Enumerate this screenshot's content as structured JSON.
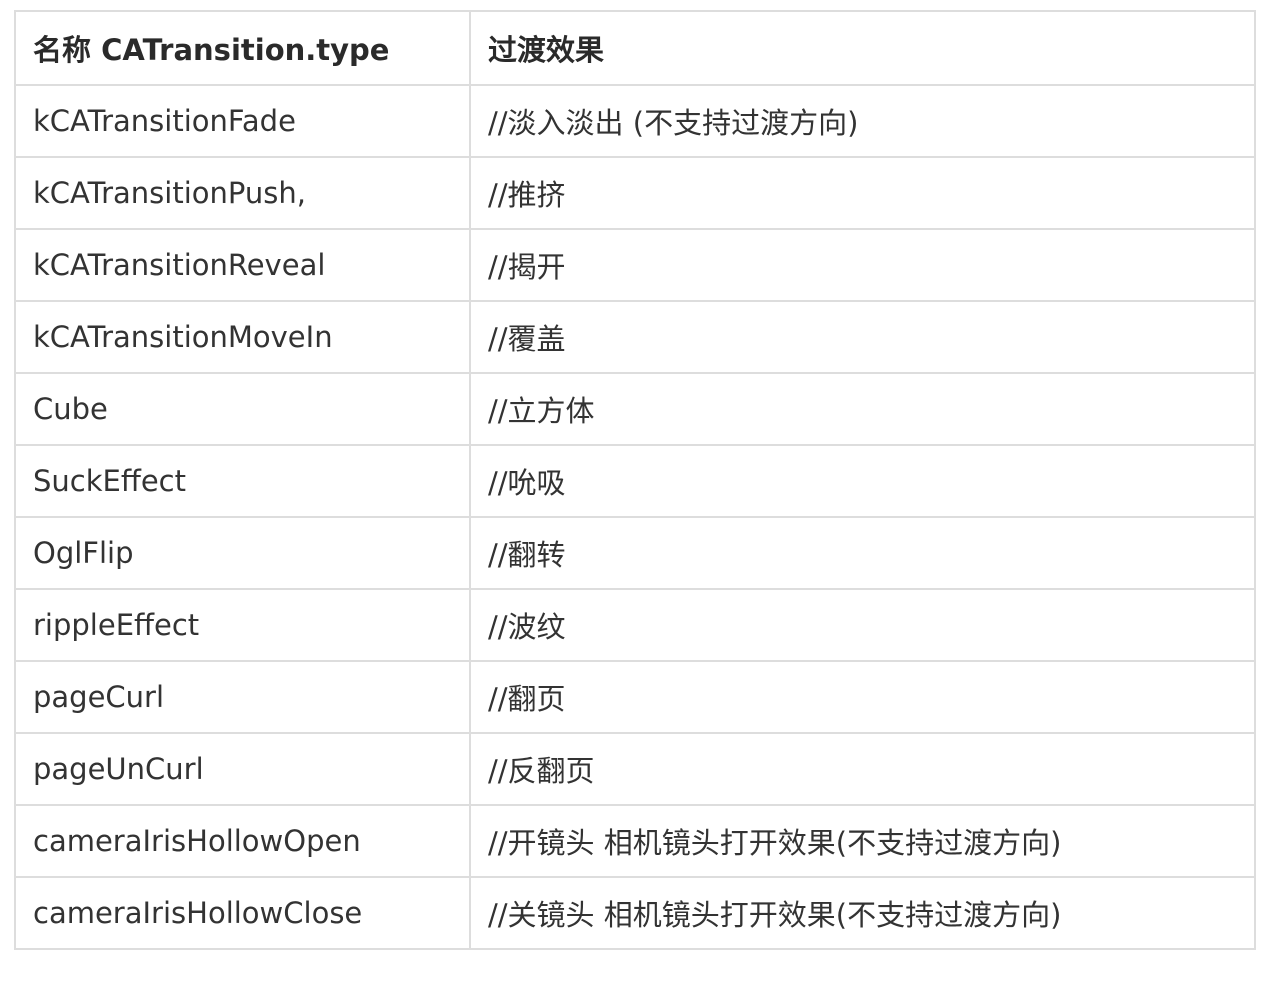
{
  "table": {
    "headers": [
      "名称 CATransition.type",
      "过渡效果"
    ],
    "rows": [
      [
        "kCATransitionFade",
        "//淡入淡出 (不支持过渡方向)"
      ],
      [
        "kCATransitionPush,",
        "//推挤"
      ],
      [
        "kCATransitionReveal",
        "//揭开"
      ],
      [
        "kCATransitionMoveIn",
        "//覆盖"
      ],
      [
        "Cube",
        "//立方体"
      ],
      [
        "SuckEffect",
        "//吮吸"
      ],
      [
        "OglFlip",
        "//翻转"
      ],
      [
        "rippleEffect",
        "//波纹"
      ],
      [
        "pageCurl",
        "//翻页"
      ],
      [
        "pageUnCurl",
        "//反翻页"
      ],
      [
        "cameraIrisHollowOpen",
        "//开镜头 相机镜头打开效果(不支持过渡方向)"
      ],
      [
        "cameraIrisHollowClose",
        "//关镜头 相机镜头打开效果(不支持过渡方向)"
      ]
    ]
  },
  "colors": {
    "border": "#dddddd",
    "text": "#333333",
    "background": "#ffffff"
  }
}
